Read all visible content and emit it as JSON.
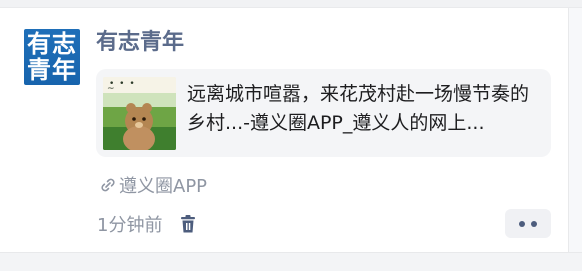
{
  "post": {
    "avatar_text": [
      "有志",
      "青年"
    ],
    "author": "有志青年",
    "share": {
      "title": "远离城市喧嚣，来花茂村赴一场慢节奏的乡村...-遵义圈APP_遵义人的网上...",
      "thumbnail_caption": "• • •"
    },
    "source": "遵义圈APP",
    "time": "1分钟前"
  },
  "colors": {
    "avatar_bg": "#1f6fb8",
    "author": "#5b6b8b",
    "meta": "#8f96a3",
    "card_bg": "#f4f5f7"
  },
  "icons": {
    "link": "link-icon",
    "trash": "trash-icon",
    "more": "more-dots-icon"
  }
}
